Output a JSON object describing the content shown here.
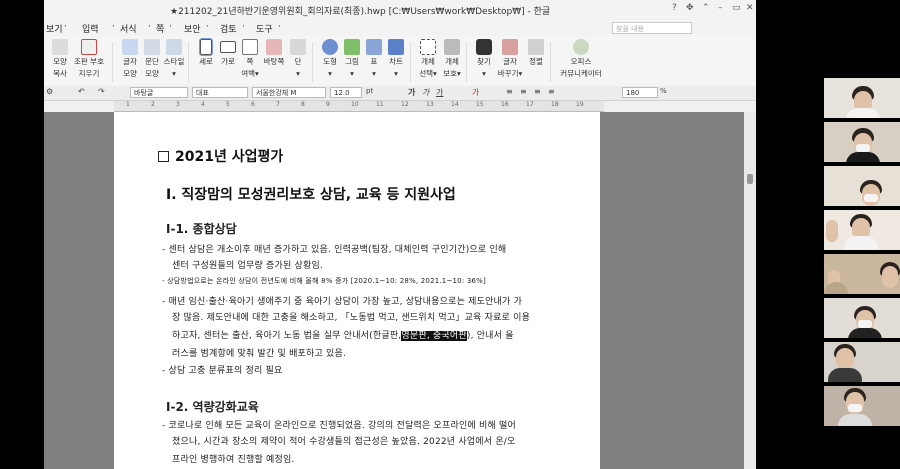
{
  "window": {
    "title": "★211202_21년하반기운영위원회_회의자료(최종).hwp [C:₩Users₩work₩Desktop₩] - 한글"
  },
  "menu": {
    "items": [
      "보기",
      "입력",
      "서식",
      "쪽",
      "보안",
      "검토",
      "도구"
    ],
    "search_placeholder": "찾을 내용"
  },
  "ribbon": {
    "buttons": [
      {
        "id": "mouse-copy",
        "label1": "모양",
        "label2": "복사"
      },
      {
        "id": "style-remove",
        "label1": "조판 부호",
        "label2": "지우기"
      },
      {
        "id": "char-shape",
        "label1": "글자",
        "label2": "모양"
      },
      {
        "id": "para-shape",
        "label1": "문단",
        "label2": "모양"
      },
      {
        "id": "style",
        "label1": "스타일",
        "label2": "▾"
      },
      {
        "id": "portrait",
        "label1": "세로",
        "label2": ""
      },
      {
        "id": "landscape",
        "label1": "가로",
        "label2": ""
      },
      {
        "id": "page-margin",
        "label1": "쪽",
        "label2": "여백▾"
      },
      {
        "id": "background",
        "label1": "바탕쪽",
        "label2": ""
      },
      {
        "id": "columns",
        "label1": "단",
        "label2": "▾"
      },
      {
        "id": "shape",
        "label1": "도형",
        "label2": "▾"
      },
      {
        "id": "picture",
        "label1": "그림",
        "label2": "▾"
      },
      {
        "id": "table",
        "label1": "표",
        "label2": "▾"
      },
      {
        "id": "chart",
        "label1": "차트",
        "label2": "▾"
      },
      {
        "id": "object-select",
        "label1": "개체",
        "label2": "선택▾"
      },
      {
        "id": "object-protect",
        "label1": "개체",
        "label2": "보호▾"
      },
      {
        "id": "find",
        "label1": "찾기",
        "label2": "▾"
      },
      {
        "id": "char-change",
        "label1": "글자",
        "label2": "바꾸기▾"
      },
      {
        "id": "sort",
        "label1": "정렬",
        "label2": ""
      },
      {
        "id": "office-communicator",
        "label1": "오피스",
        "label2": "커뮤니케이터"
      }
    ]
  },
  "format": {
    "style": "바탕글",
    "lang": "대표",
    "font": "서울한강체 M",
    "size": "12.0",
    "unit": "pt",
    "zoom": "180",
    "zoom_unit": "%"
  },
  "ruler": {
    "ticks": [
      "1",
      "2",
      "3",
      "4",
      "5",
      "6",
      "7",
      "8",
      "9",
      "10",
      "11",
      "12",
      "13",
      "14",
      "15",
      "16",
      "17",
      "18",
      "19"
    ]
  },
  "document": {
    "heading": "2021년 사업평가",
    "section1": "Ⅰ. 직장맘의 모성권리보호 상담, 교육 등 지원사업",
    "sub1": "Ⅰ-1. 종합상담",
    "b1_l1": "- 센터 상담은 개소이후 매년 증가하고 있음. 인력공백(팀장, 대체인력 구인기간)으로 인해",
    "b1_l2": "센터 구성원들의 업무량 증가된 상황임.",
    "b2_l1": "- 상담방법으로는 온라인 상담이 전년도에 비해 올해 8% 증가 [2020.1~10: 28%, 2021.1~10: 36%]",
    "b3_l1": "- 매년 임신·출산·육아기 생애주기 중 육아기 상담이 가장 높고, 상담내용으로는 제도안내가 가",
    "b3_l2": "장 많음. 제도안내에 대한 고충을 해소하고, 「노동법 먹고, 샌드위치 먹고」교육 자료로 이용",
    "b3_l3a": "하고자, 센터는 출산, 육아기 노동 법을 실무 안내서(한글판,",
    "b3_l3b": "영문판, 중국어판",
    "b3_l3c": "), 안내서 올",
    "b3_l4": "러스를 범계항에 맞춰 발간 및 배포하고 있음.",
    "b4_l1": "- 상담 고충 분류표의 정리 필요",
    "sub2": "Ⅰ-2. 역량강화교육",
    "c1_l1": "- 코로나로 인해 모든 교육이 온라인으로 진행되었음. 강의의 전달력은 오프라인에 비해 떨어",
    "c1_l2": "졌으나, 시간과 장소의 제약이 적어 수강생들의 접근성은 높았음. 2022년 사업에서 온/오",
    "c1_l3": "프라인 병행하여 진행할 예정임."
  },
  "colors": {
    "page": "#ffffff",
    "workspace": "#7f7f7f",
    "accent": "#7a9ad8"
  }
}
